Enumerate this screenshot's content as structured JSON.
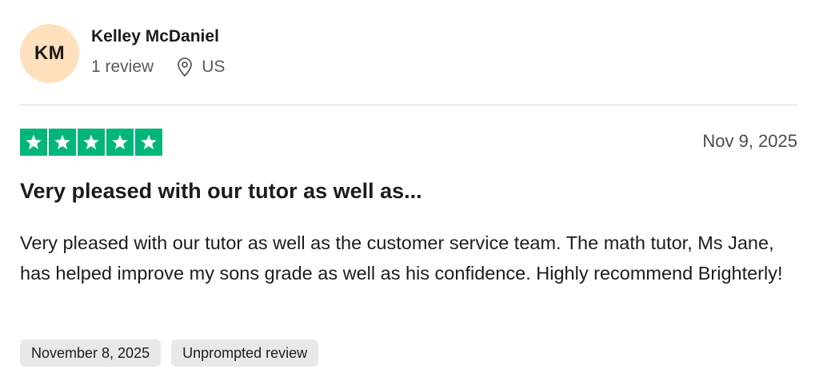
{
  "reviewer": {
    "initials": "KM",
    "name": "Kelley McDaniel",
    "review_count": "1 review",
    "location_icon": "map-pin-icon",
    "country": "US"
  },
  "review": {
    "rating": 5,
    "star_color": "#00b67a",
    "date": "Nov 9, 2025",
    "title": "Very pleased with our tutor as well as...",
    "body": "Very pleased with our tutor as well as the customer service team. The math tutor, Ms Jane, has helped improve my sons grade as well as his confidence. Highly recommend Brighterly!",
    "tags": [
      "November 8, 2025",
      "Unprompted review"
    ]
  }
}
